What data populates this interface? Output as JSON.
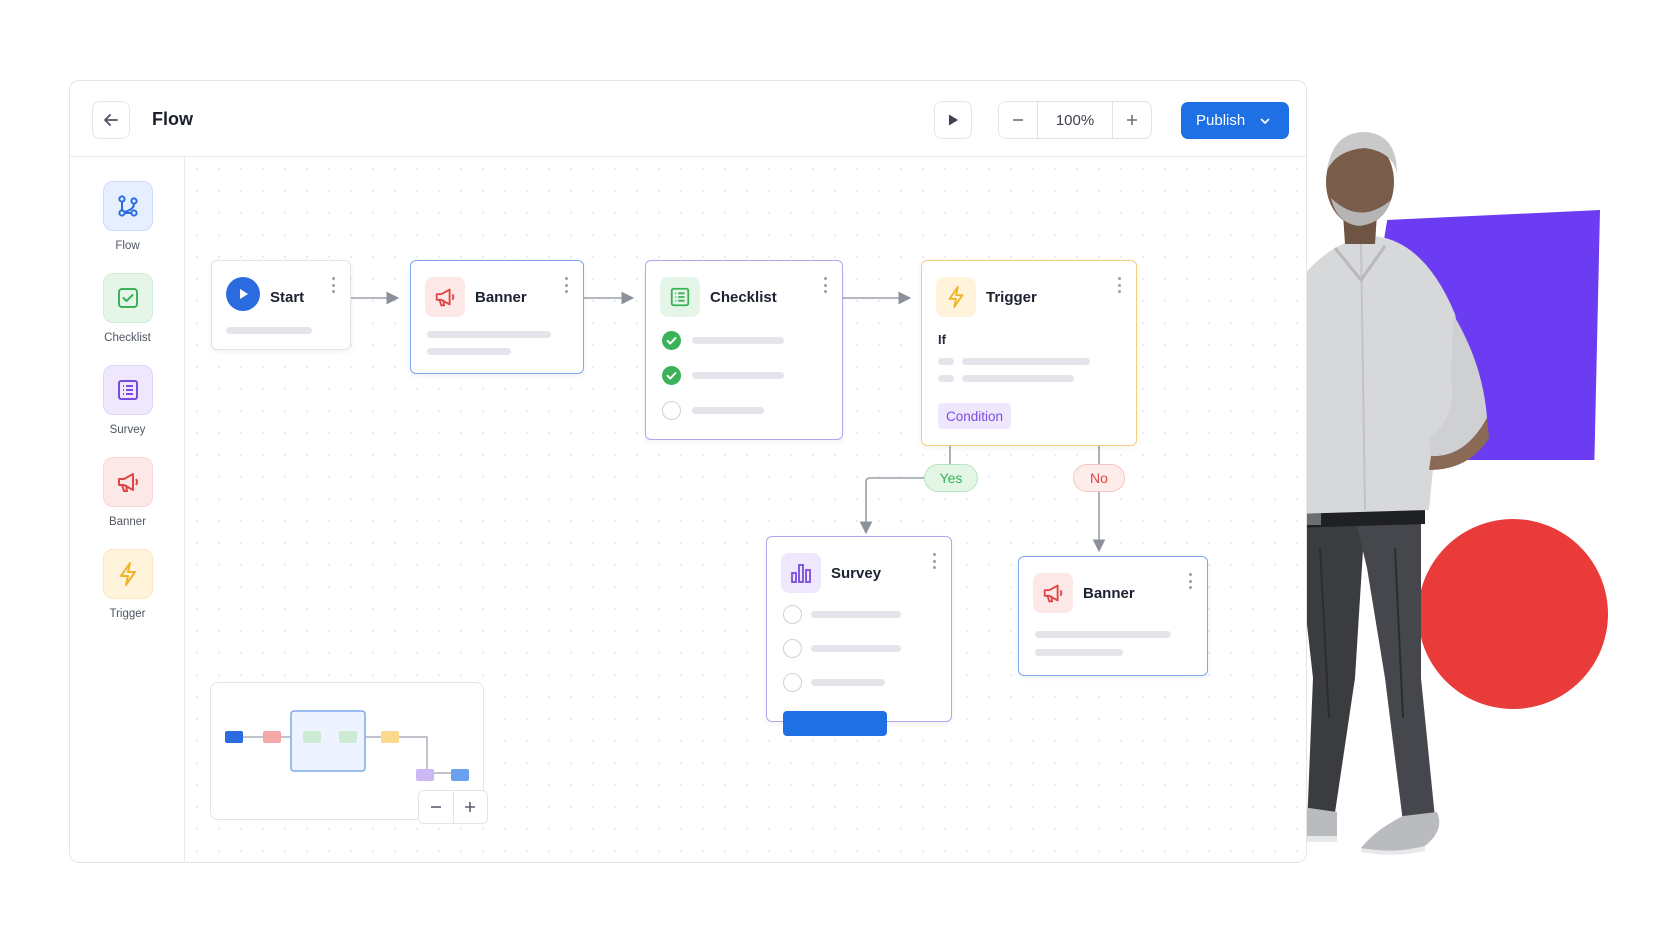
{
  "header": {
    "title": "Flow",
    "zoom": "100%",
    "publish_label": "Publish"
  },
  "sidebar": {
    "items": [
      {
        "label": "Flow",
        "icon": "flow-icon",
        "color": "#2b6be0",
        "bg": "#e6efff"
      },
      {
        "label": "Checklist",
        "icon": "checklist-icon",
        "color": "#3bb15a",
        "bg": "#e5f6e9"
      },
      {
        "label": "Survey",
        "icon": "survey-icon",
        "color": "#7a4be0",
        "bg": "#efe8fd"
      },
      {
        "label": "Banner",
        "icon": "megaphone-icon",
        "color": "#e04545",
        "bg": "#fde8e8"
      },
      {
        "label": "Trigger",
        "icon": "lightning-icon",
        "color": "#f0b429",
        "bg": "#fff3dc"
      }
    ]
  },
  "nodes": {
    "start": {
      "title": "Start"
    },
    "banner1": {
      "title": "Banner"
    },
    "checklist": {
      "title": "Checklist",
      "items_done": [
        true,
        true,
        false
      ]
    },
    "trigger": {
      "title": "Trigger",
      "if_label": "If",
      "condition_label": "Condition"
    },
    "survey": {
      "title": "Survey"
    },
    "banner2": {
      "title": "Banner"
    }
  },
  "branches": {
    "yes_label": "Yes",
    "no_label": "No"
  },
  "colors": {
    "primary": "#1f6fe5",
    "start": "#2b6be0",
    "banner": "#e04545",
    "checklist": "#3bb15a",
    "trigger": "#f0b429",
    "survey": "#7a4be0",
    "purple_block": "#6b3cf2",
    "red_circle": "#ea3b3b"
  }
}
